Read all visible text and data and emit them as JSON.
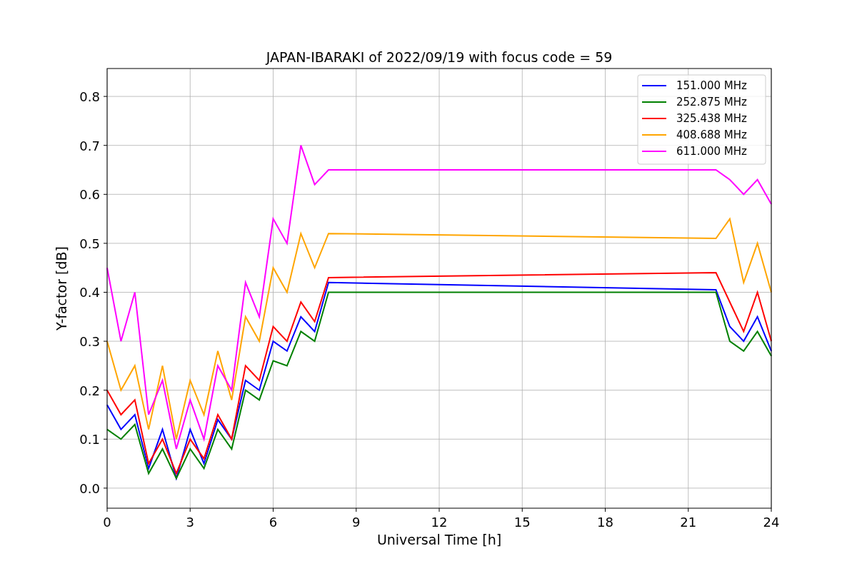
{
  "figure": {
    "chart_data": {
      "type": "line",
      "title": "JAPAN-IBARAKI of 2022/09/19 with focus code = 59",
      "xlabel": "Universal Time [h]",
      "ylabel": "Y-factor [dB]",
      "x": [
        0,
        0.5,
        1,
        1.5,
        2,
        2.5,
        3,
        3.5,
        4,
        4.5,
        5,
        5.5,
        6,
        6.5,
        7,
        7.5,
        8,
        22,
        22.5,
        23,
        23.5,
        24
      ],
      "series": [
        {
          "name": "151.000 MHz",
          "color": "#0000ff",
          "values": [
            0.17,
            0.12,
            0.15,
            0.04,
            0.12,
            0.02,
            0.12,
            0.05,
            0.14,
            0.1,
            0.22,
            0.2,
            0.3,
            0.28,
            0.35,
            0.32,
            0.42,
            0.405,
            0.33,
            0.3,
            0.35,
            0.28
          ]
        },
        {
          "name": "252.875 MHz",
          "color": "#008000",
          "values": [
            0.12,
            0.1,
            0.13,
            0.03,
            0.08,
            0.02,
            0.08,
            0.04,
            0.12,
            0.08,
            0.2,
            0.18,
            0.26,
            0.25,
            0.32,
            0.3,
            0.4,
            0.4,
            0.3,
            0.28,
            0.32,
            0.27
          ]
        },
        {
          "name": "325.438 MHz",
          "color": "#ff0000",
          "values": [
            0.2,
            0.15,
            0.18,
            0.05,
            0.1,
            0.03,
            0.1,
            0.06,
            0.15,
            0.1,
            0.25,
            0.22,
            0.33,
            0.3,
            0.38,
            0.34,
            0.43,
            0.44,
            0.38,
            0.32,
            0.4,
            0.3
          ]
        },
        {
          "name": "408.688 MHz",
          "color": "#ffa500",
          "values": [
            0.3,
            0.2,
            0.25,
            0.12,
            0.25,
            0.1,
            0.22,
            0.15,
            0.28,
            0.18,
            0.35,
            0.3,
            0.45,
            0.4,
            0.52,
            0.45,
            0.52,
            0.51,
            0.55,
            0.42,
            0.5,
            0.4
          ]
        },
        {
          "name": "611.000 MHz",
          "color": "#ff00ff",
          "values": [
            0.45,
            0.3,
            0.4,
            0.15,
            0.22,
            0.08,
            0.18,
            0.1,
            0.25,
            0.2,
            0.42,
            0.35,
            0.55,
            0.5,
            0.7,
            0.62,
            0.65,
            0.65,
            0.63,
            0.6,
            0.63,
            0.58
          ]
        }
      ],
      "grid": true,
      "legend": true,
      "xlim": [
        0,
        24
      ],
      "ylim": [
        -0.041,
        0.857
      ],
      "xticks": [
        0,
        3,
        6,
        9,
        12,
        15,
        18,
        21,
        24
      ],
      "yticks": [
        {
          "value": 0,
          "label": "0.0"
        },
        {
          "value": 0.1,
          "label": "0.1"
        },
        {
          "value": 0.2,
          "label": "0.2"
        },
        {
          "value": 0.3,
          "label": "0.3"
        },
        {
          "value": 0.4,
          "label": "0.4"
        },
        {
          "value": 0.5,
          "label": "0.5"
        },
        {
          "value": 0.6,
          "label": "0.6"
        },
        {
          "value": 0.7,
          "label": "0.7"
        },
        {
          "value": 0.8,
          "label": "0.8"
        }
      ]
    }
  }
}
